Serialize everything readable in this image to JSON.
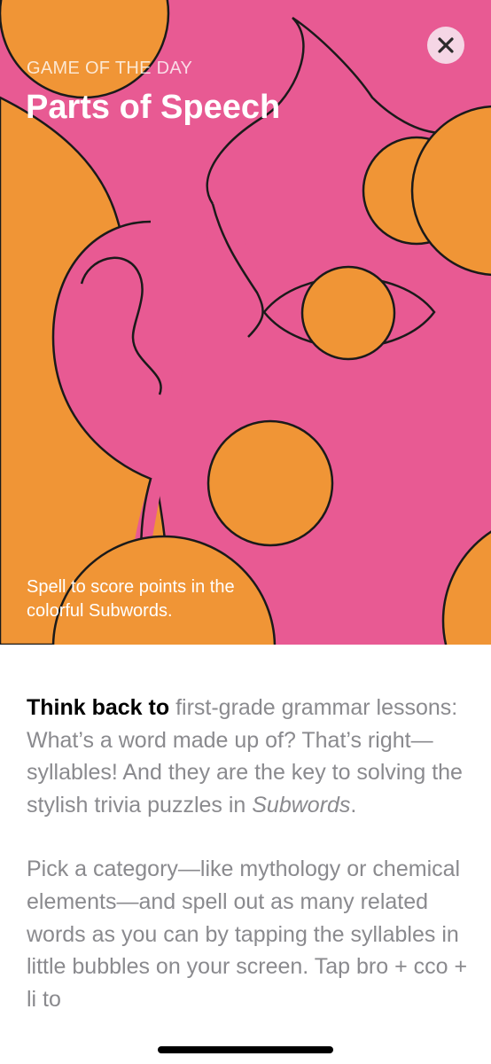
{
  "hero": {
    "eyebrow": "GAME OF THE DAY",
    "title": "Parts of Speech",
    "subtitle": "Spell to score points in the colorful Subwords.",
    "colors": {
      "pink": "#e85a93",
      "orange": "#f09536",
      "outline": "#1a1a1a"
    }
  },
  "close_button": {
    "icon": "close-icon"
  },
  "article": {
    "paragraph_1": {
      "lead": "Think back to",
      "text_1": " first-grade grammar lessons: What’s a word made up of? That’s right—syllables! And they are the key to solving the stylish trivia puzzles in ",
      "emphasis": "Subwords",
      "text_2": "."
    },
    "paragraph_2": {
      "text": "Pick a category—like mythology or chemical elements—and spell out as many related words as you can by tapping the syllables in little bubbles on your screen. Tap bro + cco + li to"
    },
    "colors": {
      "body_text": "#8a8a8e",
      "lead_text": "#000000"
    }
  }
}
